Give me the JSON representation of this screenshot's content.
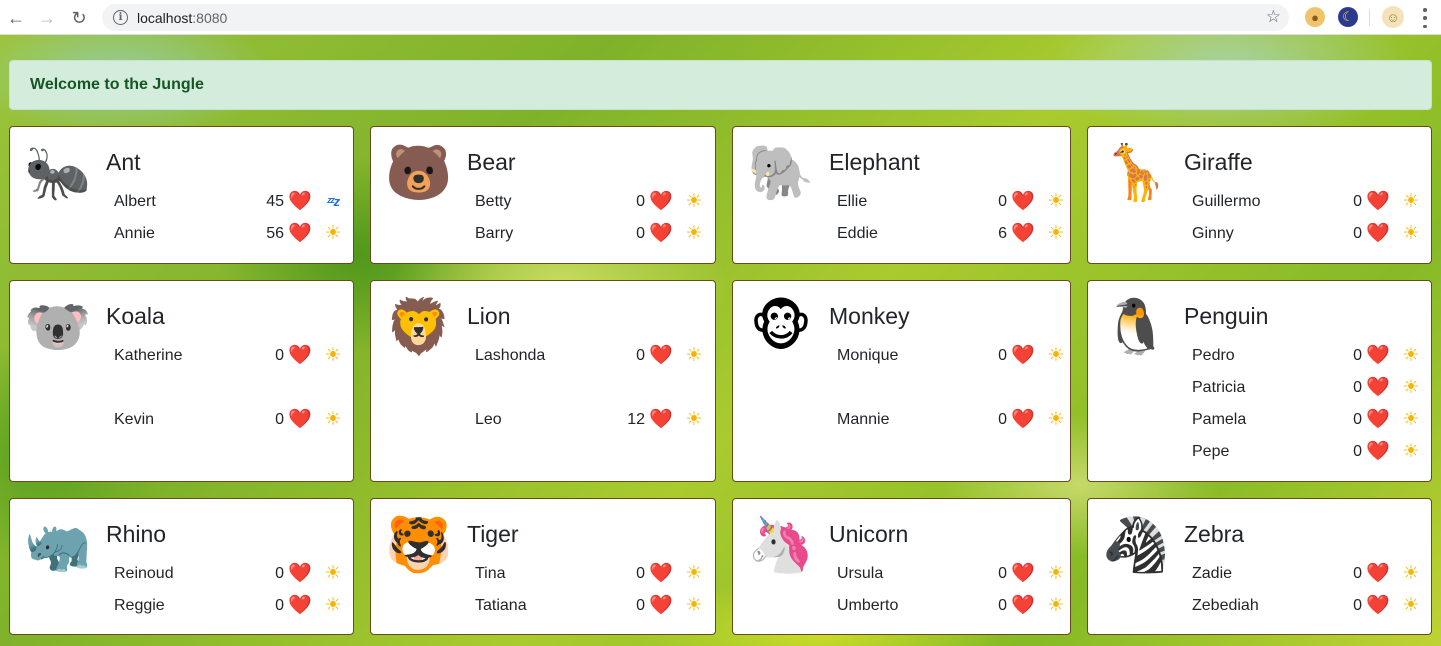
{
  "browser": {
    "url_host": "localhost",
    "url_port": ":8080"
  },
  "banner": {
    "text": "Welcome to the Jungle"
  },
  "cards": [
    {
      "title": "Ant",
      "emoji": "🐜",
      "animals": [
        {
          "name": "Albert",
          "count": "45",
          "heart": "❤️",
          "status": "ᶻᶻz"
        },
        {
          "name": "Annie",
          "count": "56",
          "heart": "❤️",
          "status": "☀"
        }
      ]
    },
    {
      "title": "Bear",
      "emoji": "🐻",
      "animals": [
        {
          "name": "Betty",
          "count": "0",
          "heart": "❤️",
          "status": "☀"
        },
        {
          "name": "Barry",
          "count": "0",
          "heart": "❤️",
          "status": "☀"
        }
      ]
    },
    {
      "title": "Elephant",
      "emoji": "🐘",
      "animals": [
        {
          "name": "Ellie",
          "count": "0",
          "heart": "❤️",
          "status": "☀"
        },
        {
          "name": "Eddie",
          "count": "6",
          "heart": "❤️",
          "status": "☀"
        }
      ]
    },
    {
      "title": "Giraffe",
      "emoji": "🦒",
      "animals": [
        {
          "name": "Guillermo",
          "count": "0",
          "heart": "❤️",
          "status": "☀"
        },
        {
          "name": "Ginny",
          "count": "0",
          "heart": "❤️",
          "status": "☀"
        }
      ]
    },
    {
      "title": "Koala",
      "emoji": "🐨",
      "animals": [
        {
          "name": "Katherine",
          "count": "0",
          "heart": "❤️",
          "status": "☀"
        },
        {
          "name": "Kevin",
          "count": "0",
          "heart": "❤️",
          "status": "☀"
        }
      ]
    },
    {
      "title": "Lion",
      "emoji": "🦁",
      "animals": [
        {
          "name": "Lashonda",
          "count": "0",
          "heart": "❤️",
          "status": "☀"
        },
        {
          "name": "Leo",
          "count": "12",
          "heart": "❤️",
          "status": "☀"
        }
      ]
    },
    {
      "title": "Monkey",
      "emoji": "🐵",
      "animals": [
        {
          "name": "Monique",
          "count": "0",
          "heart": "❤️",
          "status": "☀"
        },
        {
          "name": "Mannie",
          "count": "0",
          "heart": "❤️",
          "status": "☀"
        }
      ]
    },
    {
      "title": "Penguin",
      "emoji": "🐧",
      "animals": [
        {
          "name": "Pedro",
          "count": "0",
          "heart": "❤️",
          "status": "☀"
        },
        {
          "name": "Patricia",
          "count": "0",
          "heart": "❤️",
          "status": "☀"
        },
        {
          "name": "Pamela",
          "count": "0",
          "heart": "❤️",
          "status": "☀"
        },
        {
          "name": "Pepe",
          "count": "0",
          "heart": "❤️",
          "status": "☀"
        }
      ]
    },
    {
      "title": "Rhino",
      "emoji": "🦏",
      "animals": [
        {
          "name": "Reinoud",
          "count": "0",
          "heart": "❤️",
          "status": "☀"
        },
        {
          "name": "Reggie",
          "count": "0",
          "heart": "❤️",
          "status": "☀"
        }
      ]
    },
    {
      "title": "Tiger",
      "emoji": "🐯",
      "animals": [
        {
          "name": "Tina",
          "count": "0",
          "heart": "❤️",
          "status": "☀"
        },
        {
          "name": "Tatiana",
          "count": "0",
          "heart": "❤️",
          "status": "☀"
        }
      ]
    },
    {
      "title": "Unicorn",
      "emoji": "🦄",
      "animals": [
        {
          "name": "Ursula",
          "count": "0",
          "heart": "❤️",
          "status": "☀"
        },
        {
          "name": "Umberto",
          "count": "0",
          "heart": "❤️",
          "status": "☀"
        }
      ]
    },
    {
      "title": "Zebra",
      "emoji": "🦓",
      "animals": [
        {
          "name": "Zadie",
          "count": "0",
          "heart": "❤️",
          "status": "☀"
        },
        {
          "name": "Zebediah",
          "count": "0",
          "heart": "❤️",
          "status": "☀"
        }
      ]
    }
  ]
}
